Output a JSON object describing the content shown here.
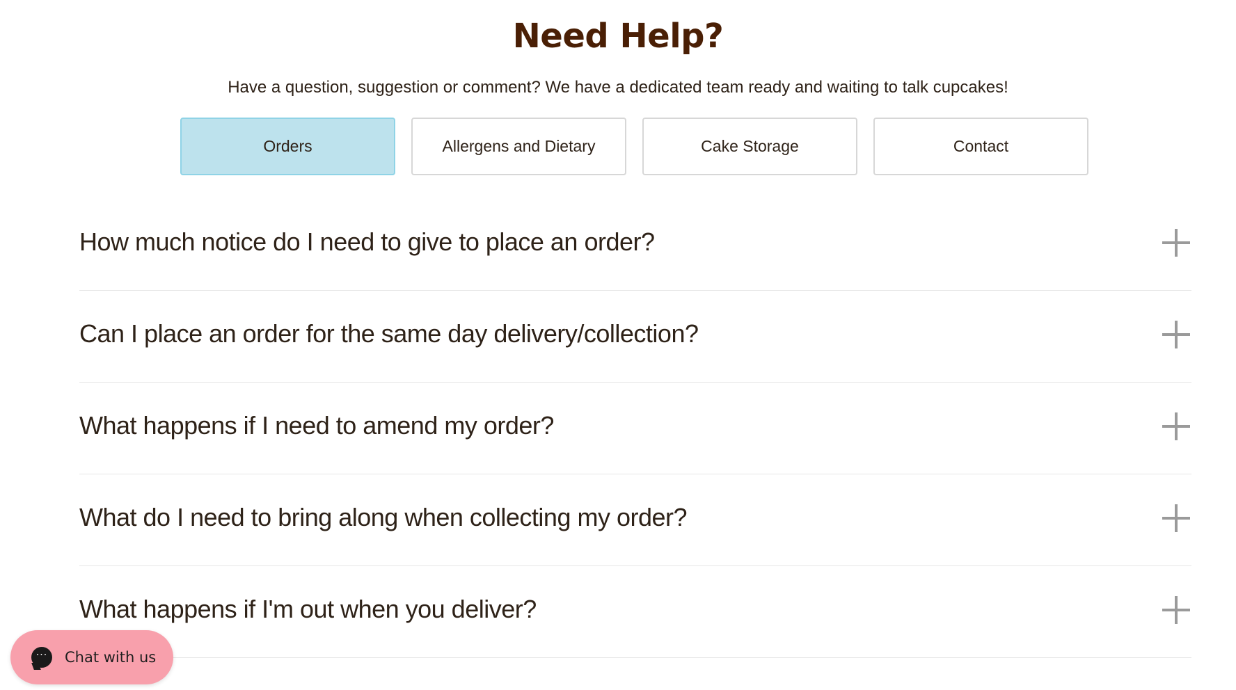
{
  "header": {
    "title": "Need Help?",
    "subtitle": "Have a question, suggestion or comment? We have a dedicated team ready and waiting to talk cupcakes!"
  },
  "tabs": [
    {
      "label": "Orders",
      "active": true
    },
    {
      "label": "Allergens and Dietary",
      "active": false
    },
    {
      "label": "Cake Storage",
      "active": false
    },
    {
      "label": "Contact",
      "active": false
    }
  ],
  "faq": [
    {
      "question": "How much notice do I need to give to place an order?",
      "icon": "plus-icon"
    },
    {
      "question": "Can I place an order for the same day delivery/collection?",
      "icon": "plus-icon"
    },
    {
      "question": "What happens if I need to amend my order?",
      "icon": "plus-icon"
    },
    {
      "question": "What do I need to bring along when collecting my order?",
      "icon": "plus-icon"
    },
    {
      "question": "What happens if I'm out when you deliver?",
      "icon": "plus-icon"
    }
  ],
  "chat": {
    "label": "Chat with us",
    "icon": "chat-bubble-icon",
    "icon_glyph": "···"
  },
  "colors": {
    "title": "#4a1f05",
    "text": "#2e2218",
    "active_tab_bg": "#bde2ed",
    "active_tab_border": "#8fd3e6",
    "tab_border": "#d7d7d7",
    "divider": "#e6e6e6",
    "plus_icon": "#9a9a9a",
    "chat_button": "#f8a0ac"
  }
}
